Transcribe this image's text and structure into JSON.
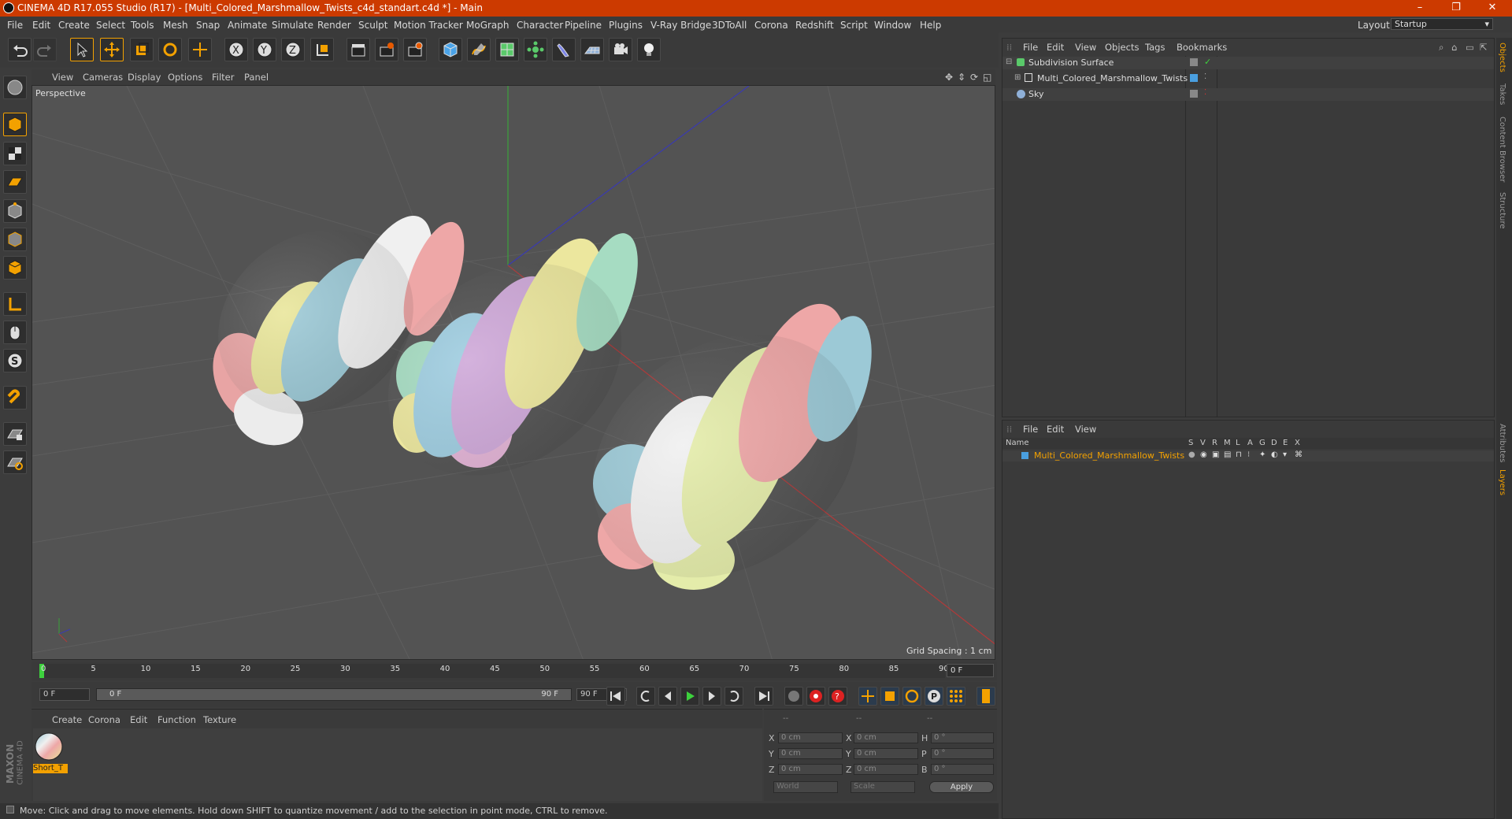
{
  "window": {
    "title": "CINEMA 4D R17.055 Studio (R17) - [Multi_Colored_Marshmallow_Twists_c4d_standart.c4d *] - Main",
    "minimize": "–",
    "maximize": "❐",
    "close": "✕"
  },
  "menu": [
    "File",
    "Edit",
    "Create",
    "Select",
    "Tools",
    "Mesh",
    "Snap",
    "Animate",
    "Simulate",
    "Render",
    "Sculpt",
    "Motion Tracker",
    "MoGraph",
    "Character",
    "Pipeline",
    "Plugins",
    "V-Ray Bridge",
    "3DToAll",
    "Corona",
    "Redshift",
    "Script",
    "Window",
    "Help"
  ],
  "layout": {
    "label": "Layout:",
    "value": "Startup"
  },
  "viewport": {
    "menu": [
      "View",
      "Cameras",
      "Display",
      "Options",
      "Filter",
      "Panel"
    ],
    "name": "Perspective",
    "grid_spacing": "Grid Spacing : 1 cm"
  },
  "timeline": {
    "ticks": [
      "0",
      "5",
      "10",
      "15",
      "20",
      "25",
      "30",
      "35",
      "40",
      "45",
      "50",
      "55",
      "60",
      "65",
      "70",
      "75",
      "80",
      "85",
      "90"
    ],
    "current_frame": "0 F",
    "start_field": "0 F",
    "range_start": "0 F",
    "range_end": "90 F",
    "end_field": "90 F"
  },
  "material_manager": {
    "menu": [
      "Create",
      "Corona",
      "Edit",
      "Function",
      "Texture"
    ],
    "material_name": "Short_T"
  },
  "coordinates": {
    "headers": [
      "--",
      "--",
      "--"
    ],
    "rows": [
      {
        "a": "X",
        "av": "0 cm",
        "b": "X",
        "bv": "0 cm",
        "c": "H",
        "cv": "0 °"
      },
      {
        "a": "Y",
        "av": "0 cm",
        "b": "Y",
        "bv": "0 cm",
        "c": "P",
        "cv": "0 °"
      },
      {
        "a": "Z",
        "av": "0 cm",
        "b": "Z",
        "bv": "0 cm",
        "c": "B",
        "cv": "0 °"
      }
    ],
    "space": "World",
    "mode": "Scale",
    "apply": "Apply"
  },
  "brand": {
    "line1": "MAXON",
    "line2": "CINEMA 4D"
  },
  "status": "Move: Click and drag to move elements. Hold down SHIFT to quantize movement / add to the selection in point mode, CTRL to remove.",
  "object_manager": {
    "menu": [
      "File",
      "Edit",
      "View",
      "Objects",
      "Tags",
      "Bookmarks"
    ],
    "objects": [
      {
        "name": "Subdivision Surface"
      },
      {
        "name": "Multi_Colored_Marshmallow_Twists"
      },
      {
        "name": "Sky"
      }
    ]
  },
  "layer_manager": {
    "menu": [
      "File",
      "Edit",
      "View"
    ],
    "header": {
      "name": "Name",
      "cols": [
        "S",
        "V",
        "R",
        "M",
        "L",
        "A",
        "G",
        "D",
        "E",
        "X"
      ]
    },
    "layers": [
      {
        "name": "Multi_Colored_Marshmallow_Twists",
        "color": "#4a9fe0"
      }
    ]
  },
  "side_tabs": [
    "Objects",
    "Takes",
    "Content Browser",
    "Structure",
    "Attributes",
    "Layers"
  ],
  "colors": {
    "title_bar": "#cc3a00",
    "selection": "#f3a100",
    "play": "#3dd13d"
  }
}
